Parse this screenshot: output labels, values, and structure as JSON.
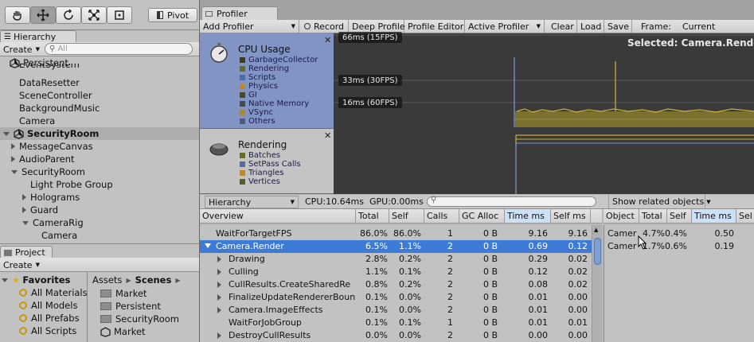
{
  "top_toolbar": {
    "pivot_label": "Pivot"
  },
  "hierarchy": {
    "tab_label": "Hierarchy",
    "create_label": "Create",
    "search_placeholder": "All",
    "rows": [
      {
        "label": "Persistent",
        "bold": false,
        "scene": true
      },
      {
        "label": "EventSystem"
      },
      {
        "label": "DataResetter"
      },
      {
        "label": "SceneController"
      },
      {
        "label": "BackgroundMusic"
      },
      {
        "label": "Camera"
      },
      {
        "label": "SecurityRoom",
        "bold": true,
        "scene": true
      },
      {
        "label": "MessageCanvas"
      },
      {
        "label": "AudioParent"
      },
      {
        "label": "SecurityRoom"
      },
      {
        "label": "Light Probe Group"
      },
      {
        "label": "Holograms"
      },
      {
        "label": "Guard"
      },
      {
        "label": "CameraRig"
      },
      {
        "label": "Camera"
      }
    ]
  },
  "project": {
    "tab_label": "Project",
    "create_label": "Create",
    "favorites_label": "Favorites",
    "favorites": [
      "All Materials",
      "All Models",
      "All Prefabs",
      "All Scripts"
    ],
    "breadcrumb": [
      "Assets",
      "Scenes"
    ],
    "assets": [
      "Market",
      "Persistent",
      "SecurityRoom",
      "Market"
    ]
  },
  "profiler": {
    "tab_label": "Profiler",
    "toolbar": {
      "add_profiler": "Add Profiler",
      "record": "Record",
      "deep_profile": "Deep Profile",
      "profile_editor": "Profile Editor",
      "active_profiler": "Active Profiler",
      "clear": "Clear",
      "load": "Load",
      "save": "Save",
      "frame_label": "Frame:",
      "frame_value": "Current"
    },
    "cpu_module": {
      "title": "CPU Usage",
      "legend": [
        {
          "name": "GarbageCollector",
          "color": "#3c3c1e"
        },
        {
          "name": "Rendering",
          "color": "#6b6b1c"
        },
        {
          "name": "Scripts",
          "color": "#4d6fa8"
        },
        {
          "name": "Physics",
          "color": "#c08a20"
        },
        {
          "name": "GI",
          "color": "#4a4a2a"
        },
        {
          "name": "Native Memory",
          "color": "#494949"
        },
        {
          "name": "VSync",
          "color": "#a98a2a"
        },
        {
          "name": "Others",
          "color": "#4d5c7a"
        }
      ],
      "lines": [
        "66ms (15FPS)",
        "33ms (30FPS)",
        "16ms (60FPS)"
      ],
      "selected_label": "Selected: Camera.Render"
    },
    "rendering_module": {
      "title": "Rendering",
      "legend": [
        {
          "name": "Batches",
          "color": "#6b6b1c"
        },
        {
          "name": "SetPass Calls",
          "color": "#4d6fa8"
        },
        {
          "name": "Triangles",
          "color": "#c08a20"
        },
        {
          "name": "Vertices",
          "color": "#5a5a2a"
        }
      ]
    },
    "details_bar": {
      "view": "Hierarchy",
      "cpu": "CPU:10.64ms",
      "gpu": "GPU:0.00ms",
      "related": "Show related objects"
    },
    "columns": [
      "Overview",
      "Total",
      "Self",
      "Calls",
      "GC Alloc",
      "Time ms",
      "Self ms"
    ],
    "rows": [
      {
        "name": "WaitForTargetFPS",
        "total": "86.0%",
        "self": "86.0%",
        "calls": "1",
        "gc": "0 B",
        "time": "9.16",
        "selfms": "9.16",
        "indent": 0,
        "expand": "none"
      },
      {
        "name": "Camera.Render",
        "total": "6.5%",
        "self": "1.1%",
        "calls": "2",
        "gc": "0 B",
        "time": "0.69",
        "selfms": "0.12",
        "indent": 0,
        "expand": "open",
        "selected": true
      },
      {
        "name": "Drawing",
        "total": "2.8%",
        "self": "0.2%",
        "calls": "2",
        "gc": "0 B",
        "time": "0.29",
        "selfms": "0.02",
        "indent": 1,
        "expand": "closed"
      },
      {
        "name": "Culling",
        "total": "1.1%",
        "self": "0.1%",
        "calls": "2",
        "gc": "0 B",
        "time": "0.12",
        "selfms": "0.02",
        "indent": 1,
        "expand": "closed"
      },
      {
        "name": "CullResults.CreateSharedRe",
        "total": "0.8%",
        "self": "0.2%",
        "calls": "2",
        "gc": "0 B",
        "time": "0.08",
        "selfms": "0.02",
        "indent": 1,
        "expand": "closed"
      },
      {
        "name": "FinalizeUpdateRendererBoun",
        "total": "0.1%",
        "self": "0.0%",
        "calls": "2",
        "gc": "0 B",
        "time": "0.01",
        "selfms": "0.00",
        "indent": 1,
        "expand": "closed"
      },
      {
        "name": "Camera.ImageEffects",
        "total": "0.1%",
        "self": "0.0%",
        "calls": "2",
        "gc": "0 B",
        "time": "0.01",
        "selfms": "0.00",
        "indent": 1,
        "expand": "closed"
      },
      {
        "name": "WaitForJobGroup",
        "total": "0.1%",
        "self": "0.1%",
        "calls": "1",
        "gc": "0 B",
        "time": "0.01",
        "selfms": "0.01",
        "indent": 1,
        "expand": "none"
      },
      {
        "name": "DestroyCullResults",
        "total": "0.0%",
        "self": "0.0%",
        "calls": "2",
        "gc": "0 B",
        "time": "0.00",
        "selfms": "0.00",
        "indent": 1,
        "expand": "closed"
      }
    ],
    "object_columns": [
      "Object",
      "Total",
      "Self",
      "Time ms",
      "Sel"
    ],
    "object_rows": [
      {
        "object": "Camer",
        "total": "4.7%",
        "self": "0.4%",
        "time": "0.50"
      },
      {
        "object": "Camer",
        "total": "1.7%",
        "self": "0.6%",
        "time": "0.19"
      }
    ]
  }
}
